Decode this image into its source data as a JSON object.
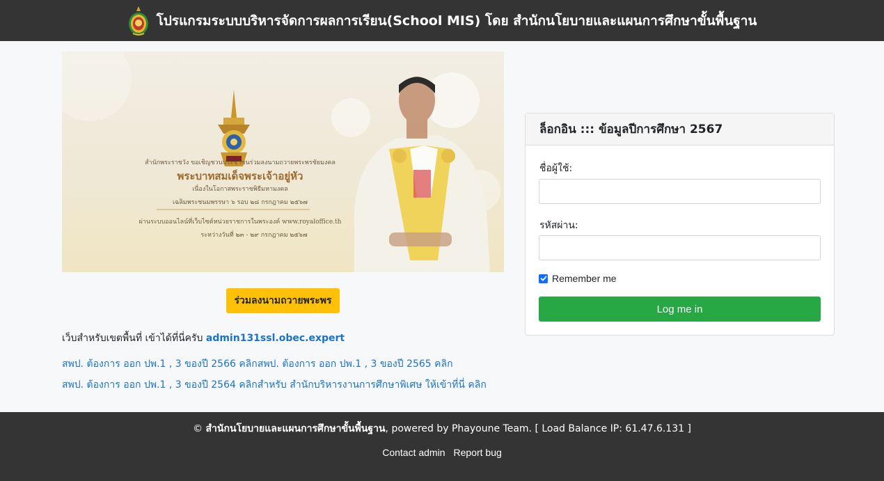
{
  "header": {
    "title": "โปรแกรมระบบบริหารจัดการผลการเรียน(School MIS) โดย สำนักนโยบายและแผนการศึกษาขั้นพื้นฐาน"
  },
  "banner": {
    "line1": "สำนักพระราชวัง ขอเชิญชวนประชาชนร่วมลงนามถวายพระพรชัยมงคล",
    "line2": "พระบาทสมเด็จพระเจ้าอยู่หัว",
    "line3": "เนื่องในโอกาสพระราชพิธีมหามงคล",
    "line4": "เฉลิมพระชนมพรรษา ๖ รอบ ๒๘ กรกฎาคม ๒๕๖๗",
    "line5": "ผ่านระบบออนไลน์ที่เว็บไซต์หน่วยราชการในพระองค์ www.royaloffice.th",
    "line6": "ระหว่างวันที่ ๒๓ - ๒๙ กรกฎาคม ๒๕๖๗"
  },
  "sign_button": "ร่วมลงนามถวายพระพร",
  "area_note": {
    "text": "เว็บสำหรับเขตพื้นที่ เข้าได้ที่นี่ครับ ",
    "link": "admin131ssl.obec.expert"
  },
  "links": {
    "row1a": "สพป. ต้องการ ออก ปพ.1 , 3 ของปี 2566 คลิก",
    "row1b": "สพป. ต้องการ ออก ปพ.1 , 3 ของปี 2565 คลิก",
    "row2a": "สพป. ต้องการ ออก ปพ.1 , 3 ของปี 2564 คลิก",
    "row2b": "สำหรับ สำนักบริหารงานการศึกษาพิเศษ ให้เข้าที่นี่ คลิก"
  },
  "login": {
    "title": "ล็อกอิน ::: ข้อมูลปีการศึกษา 2567",
    "username_label": "ชื่อผู้ใช้:",
    "username_value": "",
    "password_label": "รหัสผ่าน:",
    "password_value": "",
    "remember_label": "Remember me",
    "remember_checked": true,
    "submit_label": "Log me in"
  },
  "footer": {
    "copyright_symbol": "©",
    "org": "สำนักนโยบายและแผนการศึกษาขั้นพื้นฐาน",
    "powered": ", powered by Phayoune Team. [ Load Balance IP: 61.47.6.131 ]",
    "contact": "Contact admin",
    "report": "Report bug"
  },
  "colors": {
    "header_bg": "#343434",
    "accent_yellow": "#ffc107",
    "accent_green": "#28a745",
    "link_blue": "#1a73c9",
    "checkbox_blue": "#0d6efd"
  },
  "icons": {
    "header_logo": "obec-seal-icon",
    "check": "checkmark-icon"
  }
}
